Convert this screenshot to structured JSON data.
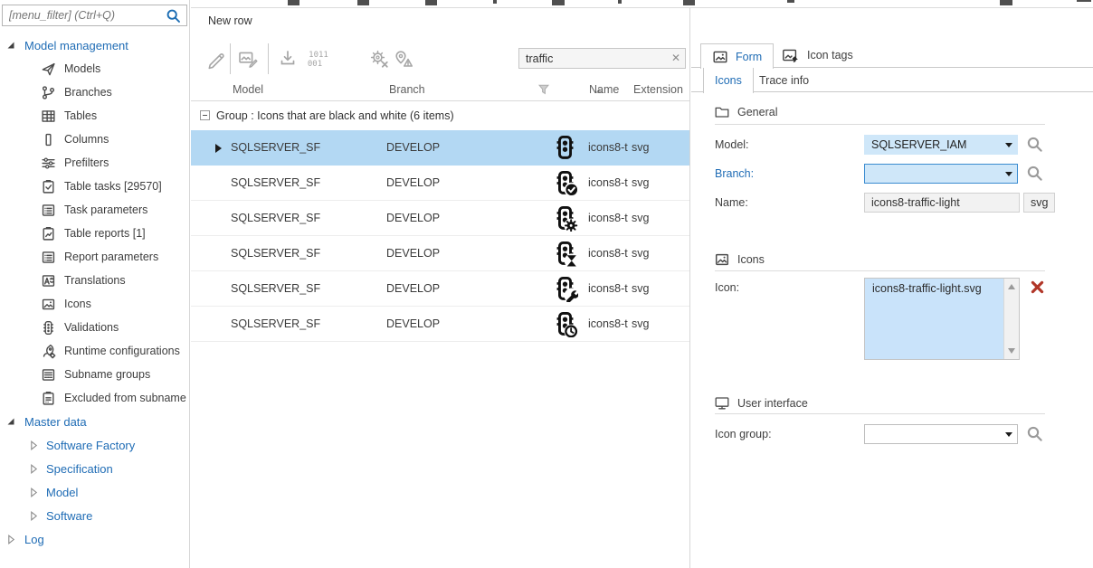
{
  "colors": {
    "accent_blue": "#1f6cb5",
    "selection_blue": "#b3d8f3",
    "combo_fill_blue": "#cfe7f9",
    "combo_focus_border": "#3a8bd0",
    "listbox_fill_blue": "#c9e3fa",
    "delete_red": "#b13628"
  },
  "sidebar": {
    "filter": {
      "placeholder": "[menu_filter] (Ctrl+Q)",
      "icon": "search-icon"
    },
    "model_management": {
      "label": "Model management",
      "items": [
        {
          "icon": "models-icon",
          "label": "Models"
        },
        {
          "icon": "branches-icon",
          "label": "Branches"
        },
        {
          "icon": "tables-icon",
          "label": "Tables"
        },
        {
          "icon": "columns-icon",
          "label": "Columns"
        },
        {
          "icon": "prefilters-icon",
          "label": "Prefilters"
        },
        {
          "icon": "table-tasks-icon",
          "label": "Table tasks [29570]"
        },
        {
          "icon": "task-parameters-icon",
          "label": "Task parameters"
        },
        {
          "icon": "table-reports-icon",
          "label": "Table reports [1]"
        },
        {
          "icon": "report-parameters-icon",
          "label": "Report parameters"
        },
        {
          "icon": "translations-icon",
          "label": "Translations"
        },
        {
          "icon": "icons-icon",
          "label": "Icons"
        },
        {
          "icon": "validations-icon",
          "label": "Validations"
        },
        {
          "icon": "runtime-configurations-icon",
          "label": "Runtime configurations"
        },
        {
          "icon": "subname-groups-icon",
          "label": "Subname groups"
        },
        {
          "icon": "excluded-from-subname-icon",
          "label": "Excluded from subname"
        }
      ]
    },
    "master_data": {
      "label": "Master data",
      "items": [
        {
          "label": "Software Factory"
        },
        {
          "label": "Specification"
        },
        {
          "label": "Model"
        },
        {
          "label": "Software"
        }
      ]
    },
    "log": {
      "label": "Log"
    }
  },
  "grid": {
    "caption": "New row",
    "toolbar": {
      "icons": [
        "edit-icon",
        "image-edit-icon",
        "import-icon",
        "binary-data-icon",
        "gear-cancel-icon",
        "location-alert-icon"
      ]
    },
    "search": {
      "value": "traffic",
      "clear": "✕"
    },
    "columns": {
      "model": "Model",
      "branch": "Branch",
      "name": "Name",
      "extension": "Extension"
    },
    "sort": {
      "column": "Name",
      "direction": "asc"
    },
    "group": {
      "label": "Group : Icons that are black and white (6 items)",
      "collapsed": false
    },
    "rows": [
      {
        "model": "SQLSERVER_SF",
        "branch": "DEVELOP",
        "icon": "traffic-light",
        "badge": "none",
        "name": "icons8-t",
        "extension": "svg",
        "selected": true
      },
      {
        "model": "SQLSERVER_SF",
        "branch": "DEVELOP",
        "icon": "traffic-light",
        "badge": "check",
        "name": "icons8-t",
        "extension": "svg",
        "selected": false
      },
      {
        "model": "SQLSERVER_SF",
        "branch": "DEVELOP",
        "icon": "traffic-light",
        "badge": "gear",
        "name": "icons8-t",
        "extension": "svg",
        "selected": false
      },
      {
        "model": "SQLSERVER_SF",
        "branch": "DEVELOP",
        "icon": "traffic-light",
        "badge": "hourglass",
        "name": "icons8-t",
        "extension": "svg",
        "selected": false
      },
      {
        "model": "SQLSERVER_SF",
        "branch": "DEVELOP",
        "icon": "traffic-light",
        "badge": "wrench",
        "name": "icons8-t",
        "extension": "svg",
        "selected": false
      },
      {
        "model": "SQLSERVER_SF",
        "branch": "DEVELOP",
        "icon": "traffic-light",
        "badge": "clock",
        "name": "icons8-t",
        "extension": "svg",
        "selected": false
      }
    ]
  },
  "panel": {
    "tabs": {
      "form": {
        "label": "Form",
        "active": true,
        "icon": "image-icon"
      },
      "icon_tags": {
        "label": "Icon tags",
        "active": false,
        "icon": "image-tag-icon"
      }
    },
    "subtabs": {
      "icons": {
        "label": "Icons",
        "active": true
      },
      "trace_info": {
        "label": "Trace info",
        "active": false
      }
    },
    "general": {
      "title": "General",
      "model_label": "Model:",
      "model_value": "SQLSERVER_IAM",
      "branch_label": "Branch:",
      "branch_value": "",
      "name_label": "Name:",
      "name_value": "icons8-traffic-light",
      "name_extension": "svg"
    },
    "icons_section": {
      "title": "Icons",
      "icon_label": "Icon:",
      "icon_value": "icons8-traffic-light.svg"
    },
    "user_interface": {
      "title": "User interface",
      "icon_group_label": "Icon group:",
      "icon_group_value": ""
    }
  }
}
